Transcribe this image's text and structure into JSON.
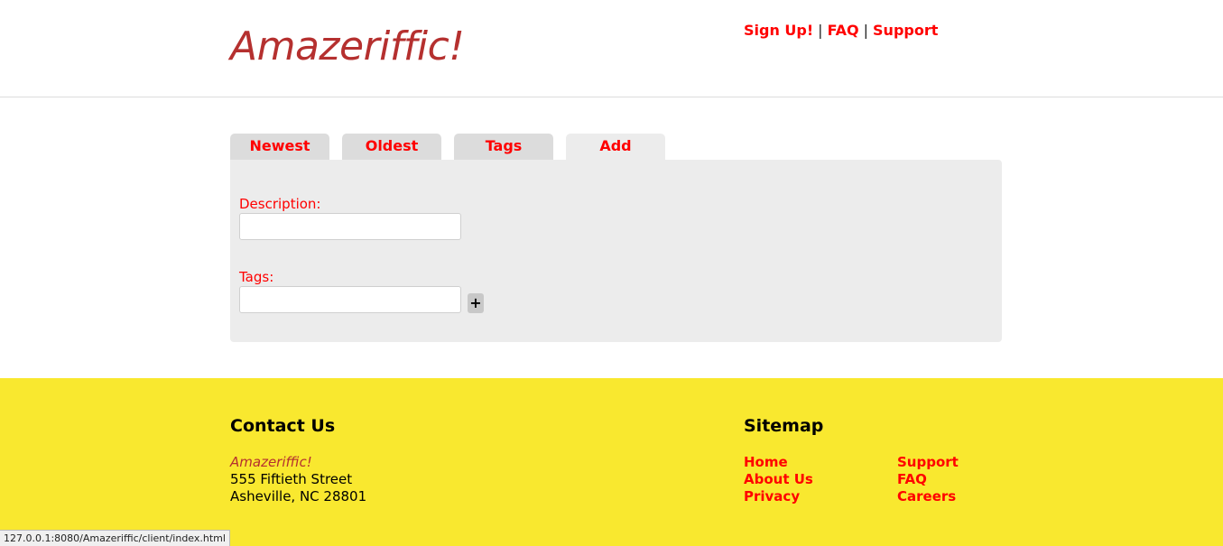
{
  "header": {
    "brand": "Amazeriffic!",
    "nav": {
      "signup": "Sign Up!",
      "faq": "FAQ",
      "support": "Support",
      "separator": "|"
    }
  },
  "tabs": [
    {
      "label": "Newest",
      "active": false
    },
    {
      "label": "Oldest",
      "active": false
    },
    {
      "label": "Tags",
      "active": false
    },
    {
      "label": "Add",
      "active": true
    }
  ],
  "form": {
    "description_label": "Description:",
    "description_value": "",
    "tags_label": "Tags:",
    "tags_value": "",
    "add_tag_button": "+"
  },
  "footer": {
    "contact_heading": "Contact Us",
    "company": "Amazeriffic!",
    "street": "555 Fiftieth Street",
    "city": "Asheville, NC 28801",
    "sitemap_heading": "Sitemap",
    "sitemap_col1": [
      "Home",
      "About Us",
      "Privacy"
    ],
    "sitemap_col2": [
      "Support",
      "FAQ",
      "Careers"
    ]
  },
  "statusbar": {
    "url": "127.0.0.1:8080/Amazeriffic/client/index.html"
  },
  "colors": {
    "brand": "#b5302f",
    "link": "#ff0000",
    "footer_bg": "#f9e82f",
    "panel_bg": "#ececec",
    "tab_bg": "#dcdcdc"
  }
}
